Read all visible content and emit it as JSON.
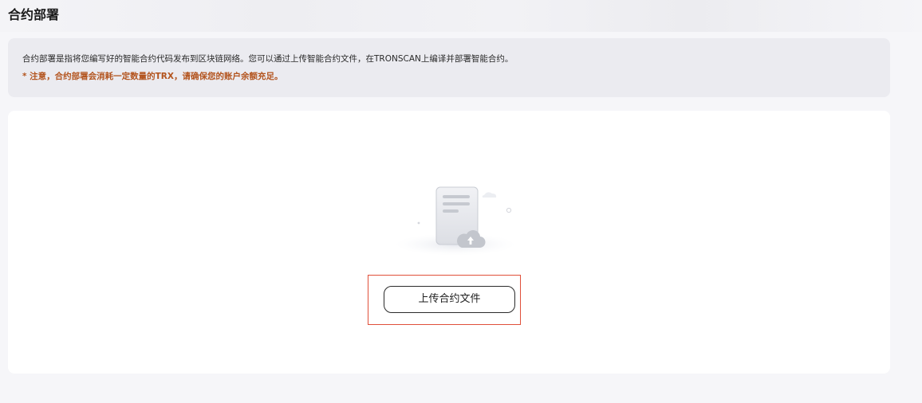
{
  "page": {
    "title": "合约部署"
  },
  "notice": {
    "text": "合约部署是指将您编写好的智能合约代码发布到区块链网络。您可以通过上传智能合约文件，在TRONSCAN上编译并部署智能合约。",
    "warning": "* 注意，合约部署会消耗一定数量的TRX，请确保您的账户余额充足。"
  },
  "upload": {
    "button_label": "上传合约文件",
    "illustration_icon": "document-upload-icon",
    "highlight_color": "#e0503a"
  },
  "colors": {
    "warning": "#b3541e",
    "panel": "#ffffff",
    "notice_bg": "#ebebf0"
  }
}
